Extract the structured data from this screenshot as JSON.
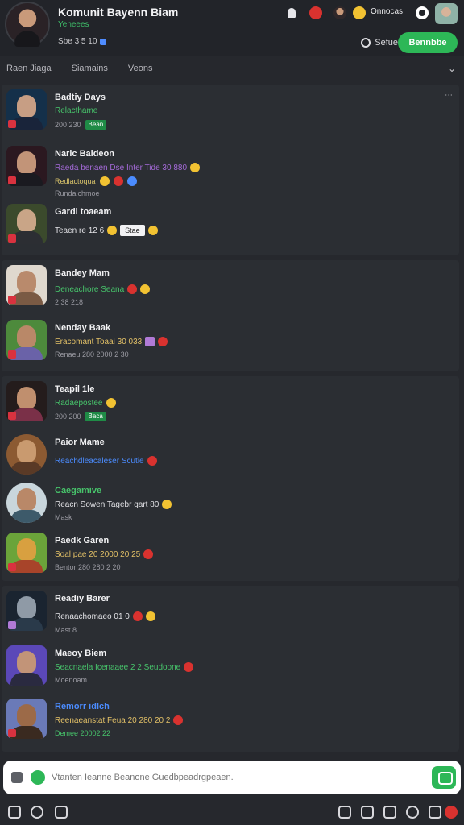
{
  "header": {
    "title": "Komunit Bayenn Biam",
    "subtitle": "Yeneees",
    "stats": "Sbe 3 5 10",
    "user_label": "Onnocas",
    "settings_label": "Sefue",
    "join_label": "Bennbbe"
  },
  "tabs": [
    {
      "label": "Raen Jiaga"
    },
    {
      "label": "Siamains"
    },
    {
      "label": "Veons"
    }
  ],
  "colors": {
    "accent": "#2db757",
    "background": "#26282d",
    "name_text": "#f1f1f3",
    "status_text": "#47c46b"
  },
  "rows": [
    {
      "name": "Badtiy Days",
      "line1": "Relacthame",
      "line2": "200 230",
      "tag": "Bean"
    },
    {
      "name": "Naric Baldeon",
      "line1": "Raeda benaen Dse Inter Tide 30 880",
      "line2": "Redlactoqua",
      "line3": "Rundalchmoe"
    },
    {
      "name": "Gardi toaeam",
      "line1": "Teaen re 12 6",
      "tag": "Stae"
    },
    {
      "name": "Bandey Mam",
      "line1": "Deneachore Seana",
      "line2": "2 38 218"
    },
    {
      "name": "Nenday Baak",
      "line1": "Eracomant Toaai 30 033",
      "line2": "Renaeu 280 2000 2 30"
    },
    {
      "name": "Teapil 1le",
      "line1": "Radaepostee",
      "line2": "200 200",
      "tag": "Baca"
    },
    {
      "name": "Paior Mame",
      "line1": "Reachdleacaleser Scutie"
    },
    {
      "name": "Caegamive",
      "line1": "Reacn Sowen Tagebr gart 80",
      "line2": "Mask"
    },
    {
      "name": "Paedk Garen",
      "line1": "Soal pae 20 2000 20 25",
      "line2": "Bentor 280 280 2 20"
    },
    {
      "name": "Readiy Barer",
      "line1": "Renaachomaeo 01 0",
      "line2": "Mast 8"
    },
    {
      "name": "Maeoy Biem",
      "line1": "Seacnaela Icenaaee 2 2 Seudoone",
      "line2": "Moenoam"
    },
    {
      "name": "Remorr idlch",
      "line1": "Reenaeanstat Feua 20 280 20 2",
      "line2": "Demee 20002 22"
    }
  ],
  "input": {
    "placeholder": "Vtanten Ieanne Beanone Guedbpeadrgpeaen."
  }
}
